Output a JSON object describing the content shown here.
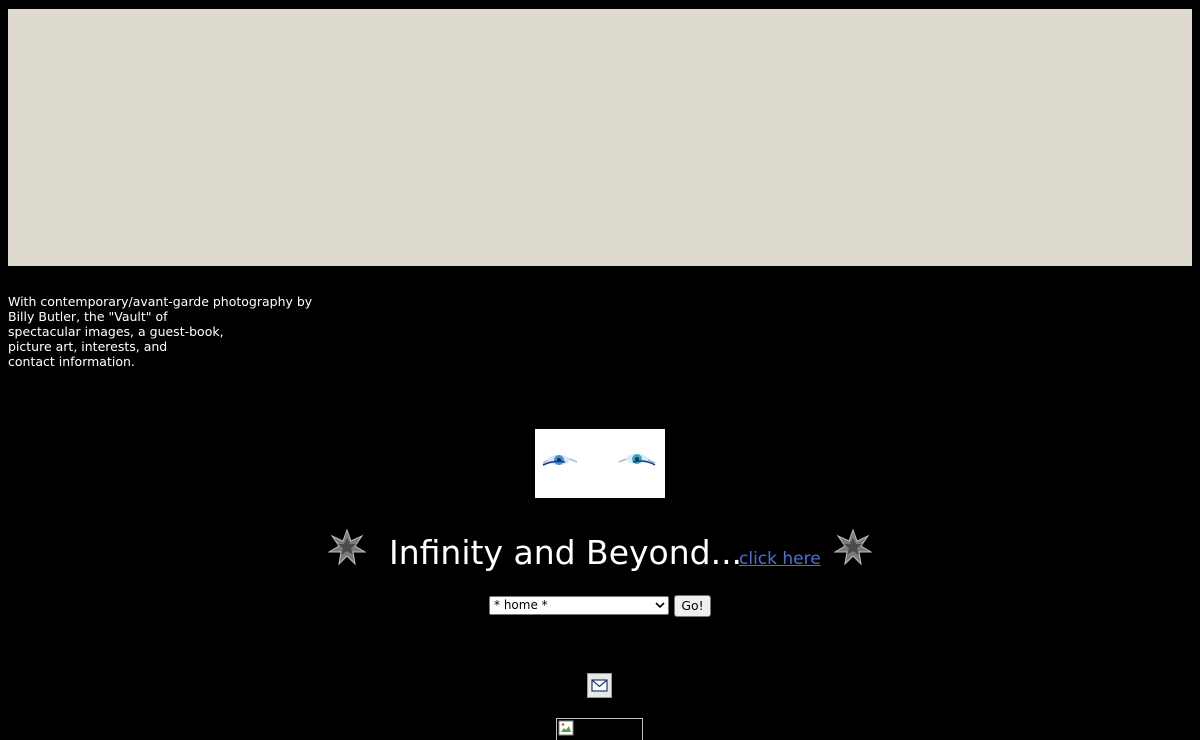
{
  "intro": {
    "lines": [
      "With contemporary/avant-garde photography by",
      "Billy Butler, the \"Vault\" of",
      "spectacular images, a guest-book,",
      "picture art, interests, and",
      "contact information."
    ]
  },
  "tagline": {
    "text": "Infinity and Beyond...",
    "link_label": "click here"
  },
  "nav": {
    "selected_option": "* home *",
    "go_label": "Go!"
  },
  "icons": {
    "star": "star-burst-icon",
    "mail": "envelope-icon",
    "broken": "broken-image-icon"
  },
  "colors": {
    "background": "#000000",
    "banner": "#dedacf",
    "link": "#4f6fd6",
    "text": "#ffffff"
  }
}
